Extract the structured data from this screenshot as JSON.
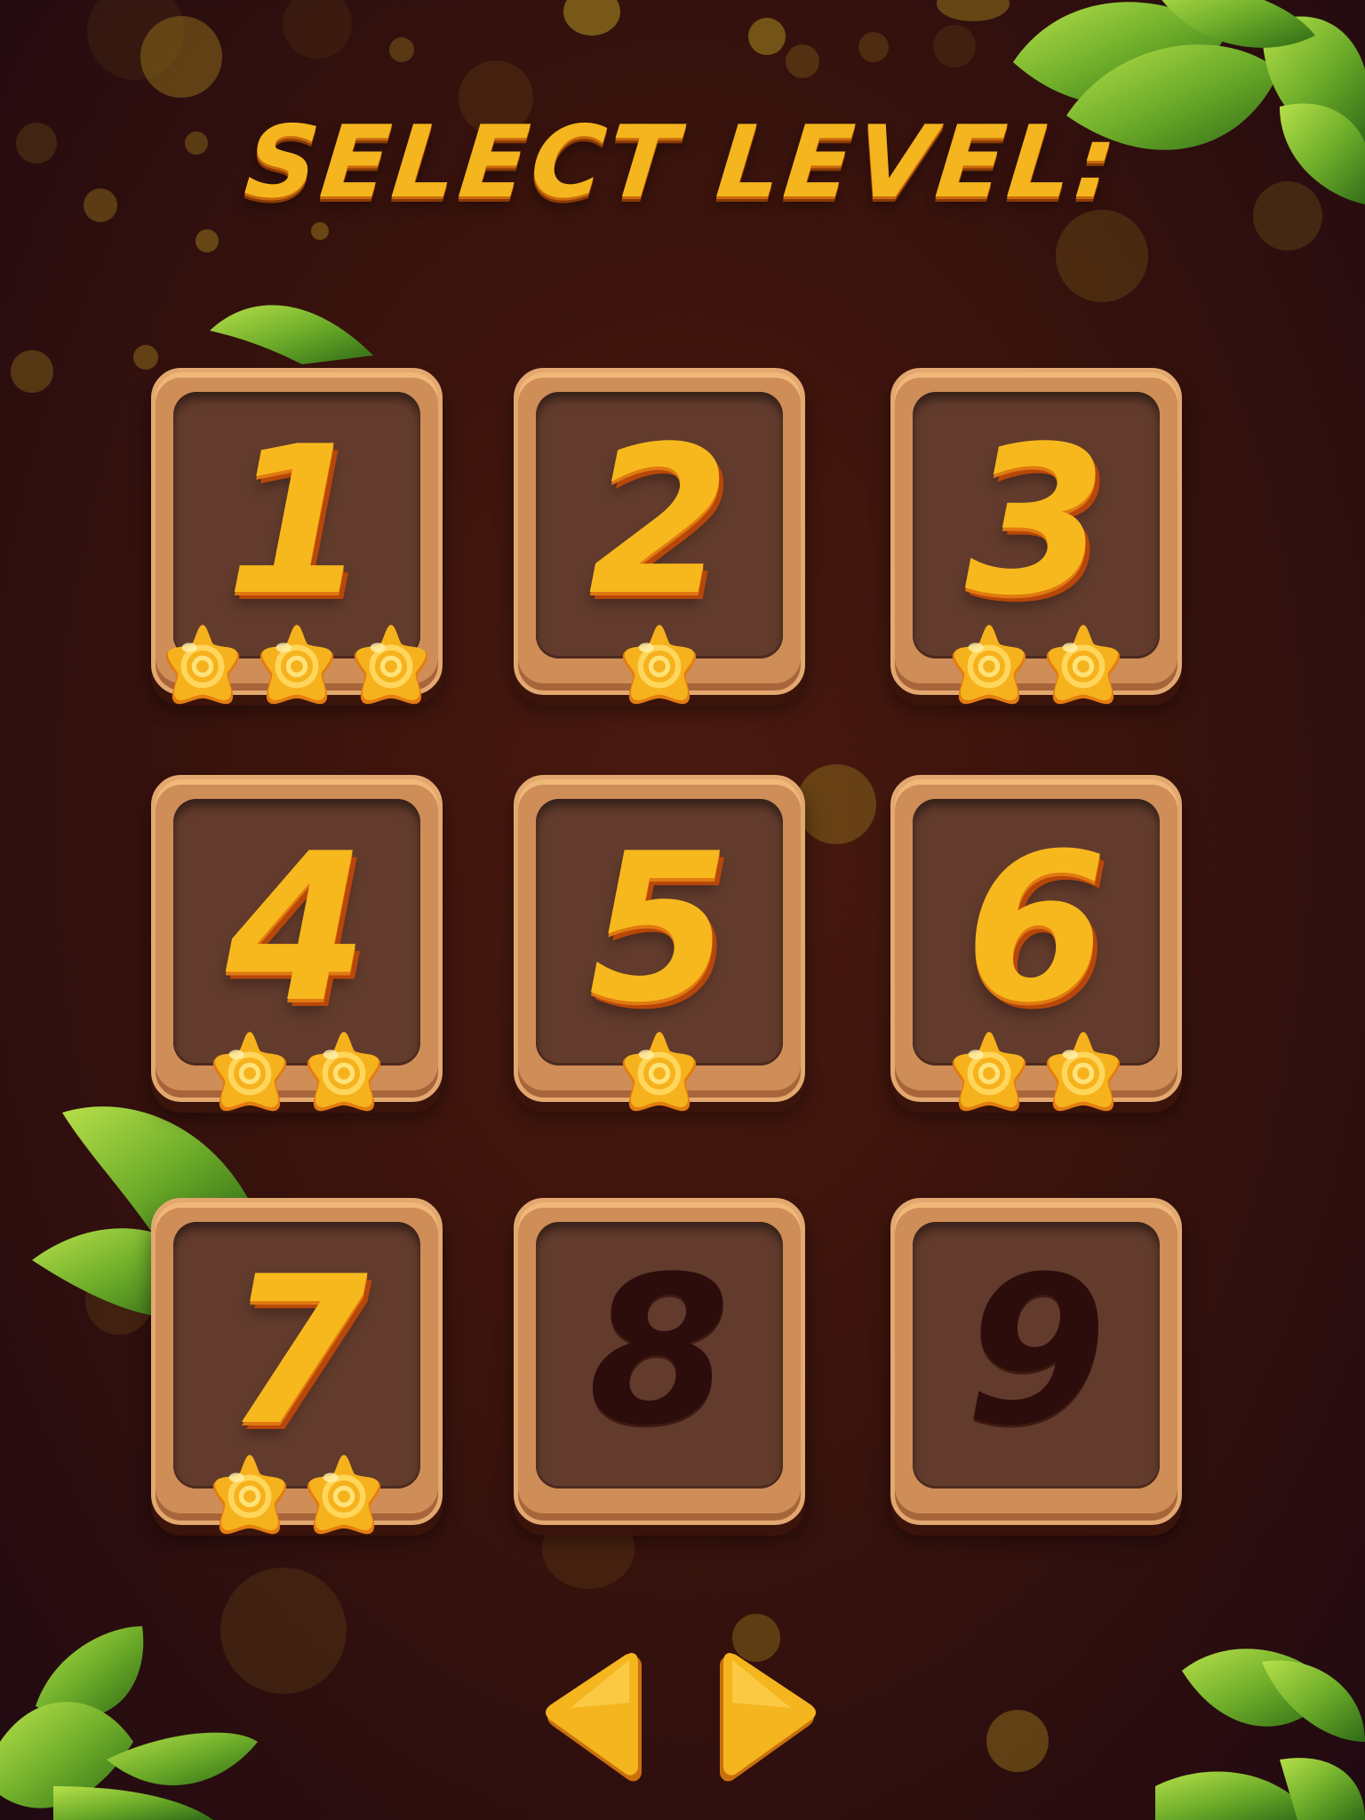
{
  "title": "SELECT LEVEL:",
  "colors": {
    "accent": "#f4b51e",
    "tile_frame": "#cf8d58",
    "tile_inner": "#623b2c",
    "locked_number": "#2d0d0c",
    "background": "#3a130c",
    "leaf": "#6fae2a"
  },
  "levels": [
    {
      "label": "1",
      "stars": 3,
      "locked": false
    },
    {
      "label": "2",
      "stars": 1,
      "locked": false
    },
    {
      "label": "3",
      "stars": 2,
      "locked": false
    },
    {
      "label": "4",
      "stars": 2,
      "locked": false
    },
    {
      "label": "5",
      "stars": 1,
      "locked": false
    },
    {
      "label": "6",
      "stars": 2,
      "locked": false
    },
    {
      "label": "7",
      "stars": 2,
      "locked": false
    },
    {
      "label": "8",
      "stars": 0,
      "locked": true
    },
    {
      "label": "9",
      "stars": 0,
      "locked": true
    }
  ],
  "navigation": {
    "prev_icon": "arrow-left-icon",
    "next_icon": "arrow-right-icon"
  },
  "decor": {
    "icon": "jungle-leaf-icon"
  }
}
